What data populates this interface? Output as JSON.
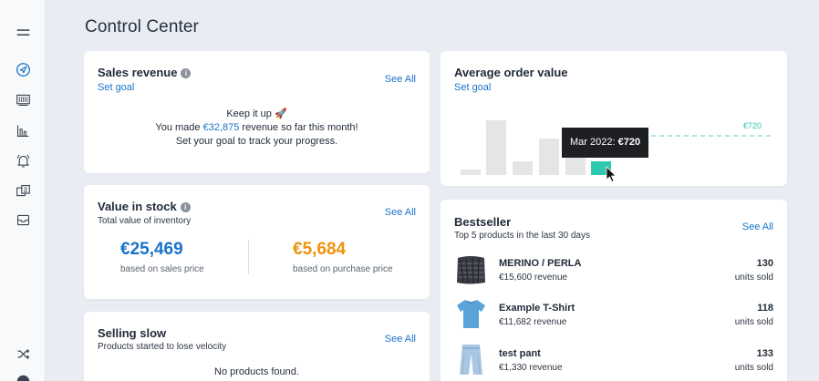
{
  "page": {
    "title": "Control Center"
  },
  "sidebar": {
    "items": [
      {
        "icon": "menu-icon"
      },
      {
        "icon": "navigation-icon",
        "active": true
      },
      {
        "icon": "barcode-icon"
      },
      {
        "icon": "bar-chart-icon"
      },
      {
        "icon": "bell-icon"
      },
      {
        "icon": "money-icon"
      },
      {
        "icon": "inbox-icon"
      },
      {
        "icon": "shuffle-icon"
      }
    ]
  },
  "sales_revenue": {
    "title": "Sales revenue",
    "see_all": "See All",
    "set_goal": "Set goal",
    "line1": "Keep it up 🚀",
    "line2_prefix": "You made ",
    "line2_amount": "€32,875",
    "line2_suffix": " revenue so far this month!",
    "line3": "Set your goal to track your progress."
  },
  "average_order": {
    "title": "Average order value",
    "set_goal": "Set goal",
    "goal_label": "€720",
    "tooltip_label": "Mar 2022:",
    "tooltip_value": "€720",
    "colors": {
      "bar": "#e5e5e5",
      "active_bar": "#2ec9b0",
      "goal_line": "#7fd9c9"
    }
  },
  "value_in_stock": {
    "title": "Value in stock",
    "subtitle": "Total value of inventory",
    "see_all": "See All",
    "sales": {
      "value": "€25,469",
      "caption": "based on sales price",
      "color": "#1a73c9"
    },
    "purchase": {
      "value": "€5,684",
      "caption": "based on purchase price",
      "color": "#f0920a"
    }
  },
  "selling_slow": {
    "title": "Selling slow",
    "subtitle": "Products started to lose velocity",
    "see_all": "See All",
    "empty": "No products found."
  },
  "bestseller": {
    "title": "Bestseller",
    "subtitle": "Top 5 products in the last 30 days",
    "see_all": "See All",
    "products": [
      {
        "name": "MERINO / PERLA",
        "revenue": "€15,600 revenue",
        "units": "130",
        "units_label": "units sold"
      },
      {
        "name": "Example T-Shirt",
        "revenue": "€11,682 revenue",
        "units": "118",
        "units_label": "units sold"
      },
      {
        "name": "test pant",
        "revenue": "€1,330 revenue",
        "units": "133",
        "units_label": "units sold"
      }
    ]
  }
}
